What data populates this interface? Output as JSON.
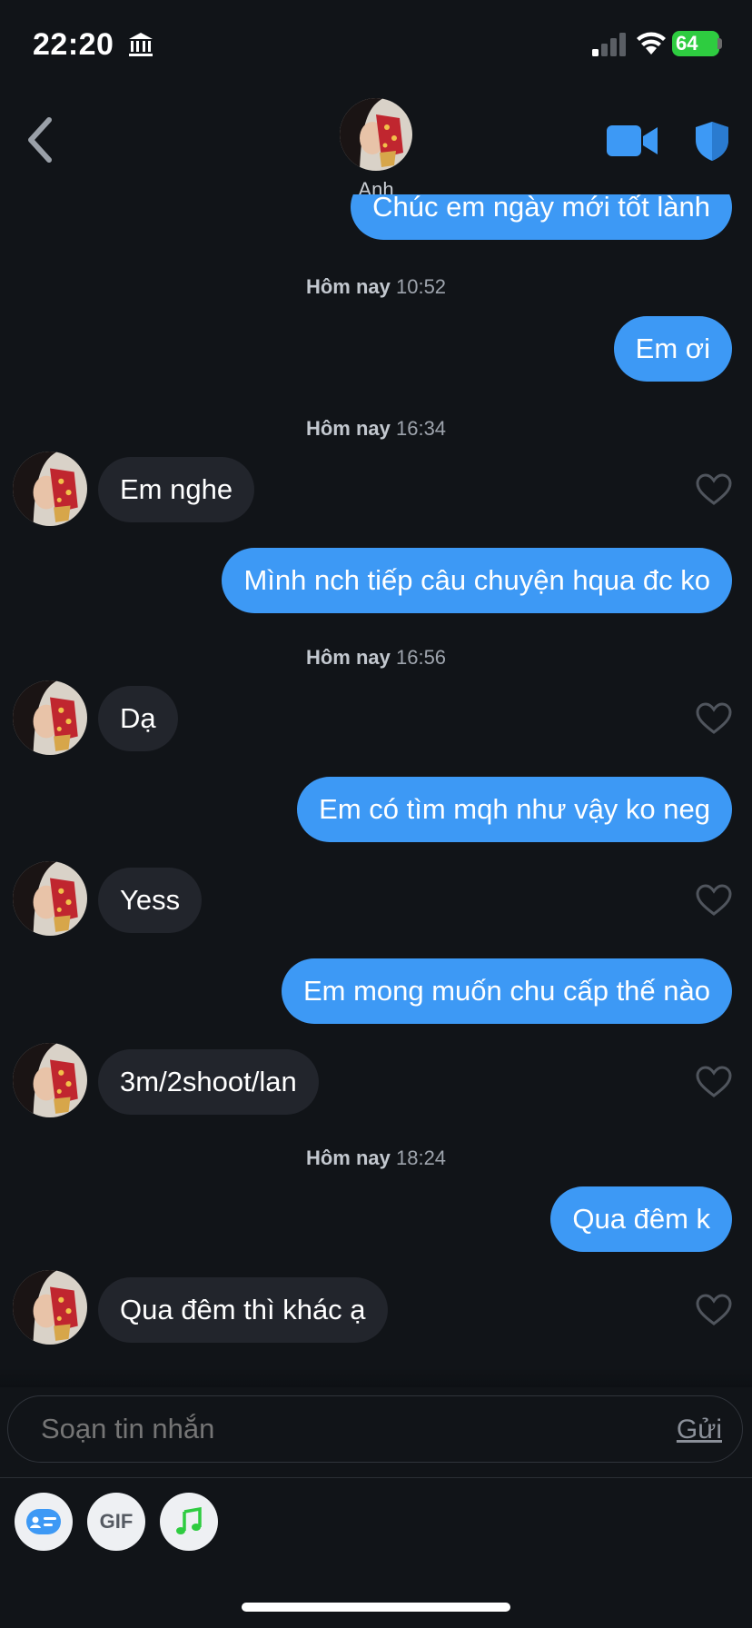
{
  "status_bar": {
    "time": "22:20",
    "battery": "64"
  },
  "header": {
    "contact_name": "Anh"
  },
  "messages": {
    "partial_top": "Chúc em ngày mới tốt lành",
    "stamp1_day": "Hôm nay",
    "stamp1_time": "10:52",
    "m1": "Em ơi",
    "stamp2_day": "Hôm nay",
    "stamp2_time": "16:34",
    "m2": "Em nghe",
    "m3": "Mình nch tiếp câu chuyện hqua đc ko",
    "stamp3_day": "Hôm nay",
    "stamp3_time": "16:56",
    "m4": "Dạ",
    "m5": "Em có tìm mqh như vậy ko neg",
    "m6": "Yess",
    "m7": "Em mong muốn chu cấp thế nào",
    "m8": "3m/2shoot/lan",
    "stamp4_day": "Hôm nay",
    "stamp4_time": "18:24",
    "m9": "Qua đêm k",
    "m10": "Qua đêm thì khác ạ"
  },
  "composer": {
    "placeholder": "Soạn tin nhắn",
    "send_label": "Gửi"
  },
  "toolbar": {
    "gif_label": "GIF"
  },
  "colors": {
    "accent": "#3d99f5",
    "background": "#111418",
    "incoming_bubble": "#22252c",
    "battery": "#2ecc40"
  },
  "icons": [
    "bank-icon",
    "signal-icon",
    "wifi-icon",
    "back-icon",
    "video-call-icon",
    "shield-icon",
    "heart-icon",
    "contact-card-icon",
    "music-note-icon"
  ]
}
